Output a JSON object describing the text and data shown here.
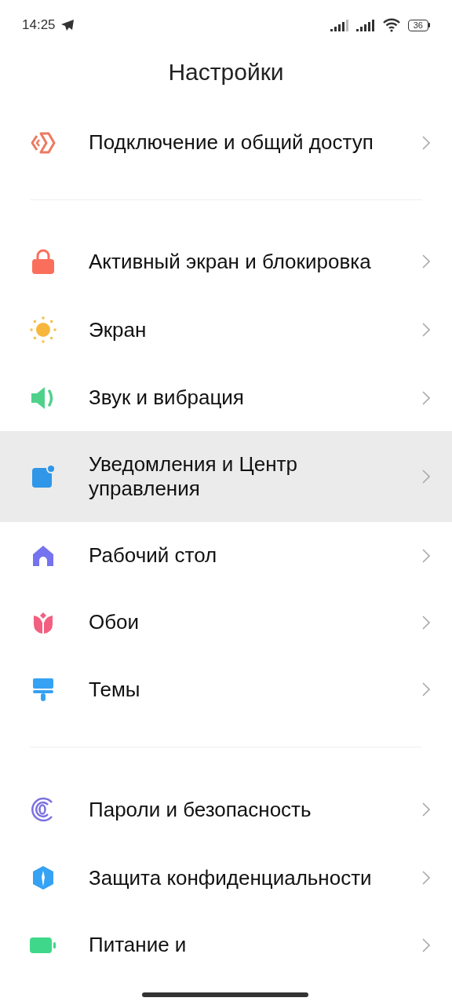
{
  "status_bar": {
    "time": "14:25",
    "battery": "36"
  },
  "title": "Настройки",
  "groups": [
    {
      "items": [
        {
          "label": "Подключение и общий доступ",
          "selected": false
        }
      ]
    },
    {
      "items": [
        {
          "label": "Активный экран и блокировка",
          "selected": false
        },
        {
          "label": "Экран",
          "selected": false
        },
        {
          "label": "Звук и вибрация",
          "selected": false
        },
        {
          "label": "Уведомления и Центр управления",
          "selected": true
        },
        {
          "label": "Рабочий стол",
          "selected": false
        },
        {
          "label": "Обои",
          "selected": false
        },
        {
          "label": "Темы",
          "selected": false
        }
      ]
    },
    {
      "items": [
        {
          "label": "Пароли и безопасность",
          "selected": false
        },
        {
          "label": "Защита конфиденциальности",
          "selected": false
        },
        {
          "label": "Питание и",
          "selected": false
        }
      ]
    }
  ]
}
